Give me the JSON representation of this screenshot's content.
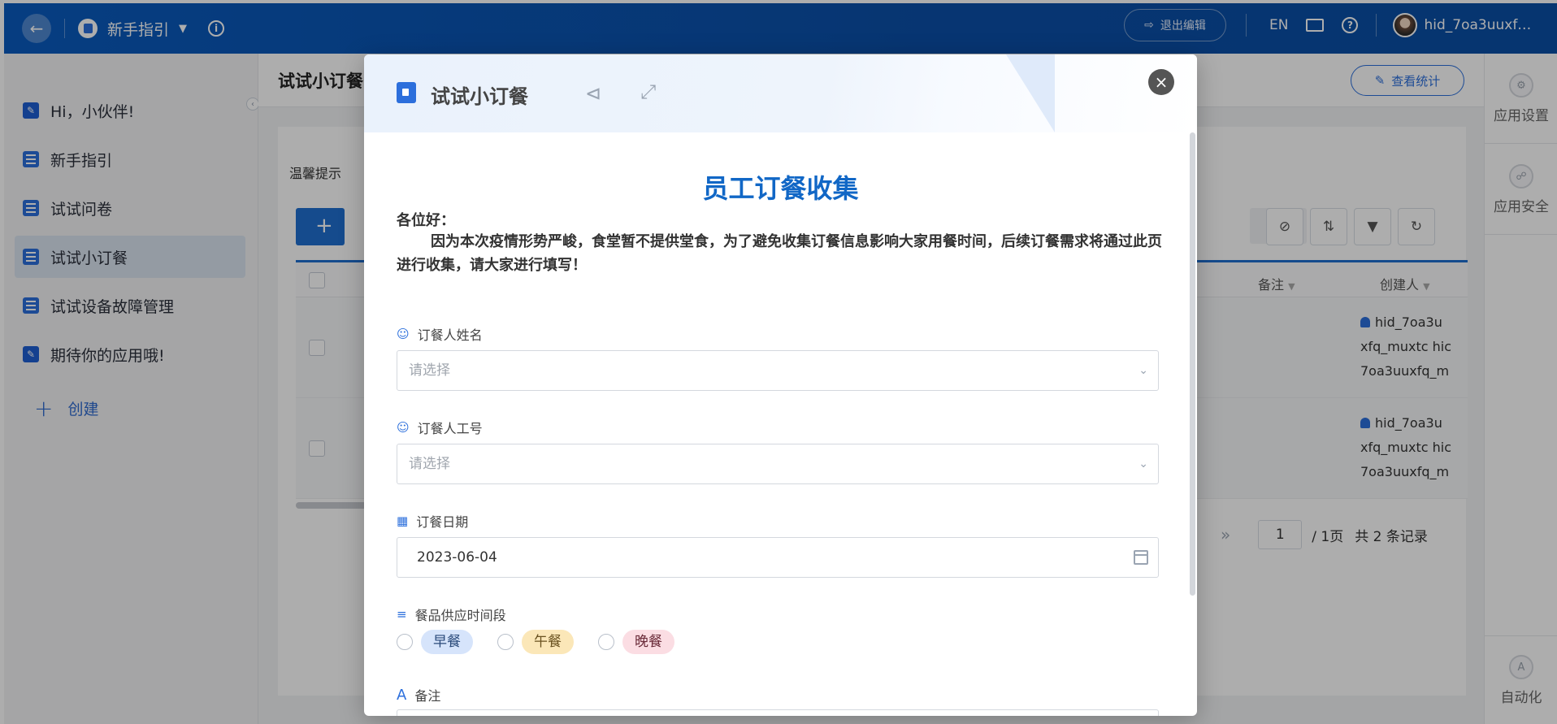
{
  "topbar": {
    "app_title": "新手指引",
    "exit_edit_label": "退出编辑",
    "lang": "EN",
    "username": "hid_7oa3uuxf…"
  },
  "sidebar": {
    "items": [
      {
        "label": "Hi，小伙伴!",
        "icon": "edit-icon"
      },
      {
        "label": "新手指引",
        "icon": "doc-list-icon"
      },
      {
        "label": "试试问卷",
        "icon": "doc-list-icon"
      },
      {
        "label": "试试小订餐",
        "icon": "doc-list-icon",
        "active": true
      },
      {
        "label": "试试设备故障管理",
        "icon": "doc-list-icon"
      },
      {
        "label": "期待你的应用哦!",
        "icon": "edit-icon"
      }
    ],
    "create_label": "创建"
  },
  "main": {
    "title": "试试小订餐",
    "stats_button": "查看统计",
    "tip": "温馨提示",
    "columns": {
      "remark": "备注",
      "creator": "创建人"
    },
    "rows": [
      {
        "creator_lines": [
          "hid_7oa3u",
          "xfq_muxtc hic",
          "7oa3uuxfq_m"
        ]
      },
      {
        "creator_lines": [
          "hid_7oa3u",
          "xfq_muxtc hic",
          "7oa3uuxfq_m"
        ]
      }
    ],
    "pager": {
      "page": "1",
      "total_pages": "/ 1页",
      "records": "共 2 条记录"
    }
  },
  "rightbar": {
    "app_settings": "应用设置",
    "app_security": "应用安全",
    "automation": "自动化"
  },
  "modal": {
    "title": "试试小订餐",
    "form_title": "员工订餐收集",
    "greeting": "各位好：",
    "body": "因为本次疫情形势严峻，食堂暂不提供堂食，为了避免收集订餐信息影响大家用餐时间，后续订餐需求将通过此页进行收集，请大家进行填写！",
    "fields": {
      "name_label": "订餐人姓名",
      "name_placeholder": "请选择",
      "id_label": "订餐人工号",
      "id_placeholder": "请选择",
      "date_label": "订餐日期",
      "date_value": "2023-06-04",
      "period_label": "餐品供应时间段",
      "periods": [
        {
          "label": "早餐",
          "color": "#d6e4fb"
        },
        {
          "label": "午餐",
          "color": "#fbe7b8"
        },
        {
          "label": "晚餐",
          "color": "#fbdde3"
        }
      ],
      "remark_label": "备注"
    }
  },
  "colors": {
    "accent": "#1f6fd0",
    "topbar": "#0a5bbf",
    "form_title": "#1167c6"
  }
}
